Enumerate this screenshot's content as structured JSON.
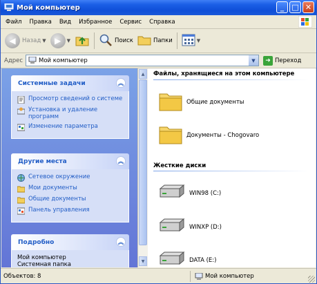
{
  "window": {
    "title": "Мой компьютер",
    "controls": {
      "minimize": "_",
      "maximize": "□",
      "close": "✕"
    }
  },
  "menu": [
    "Файл",
    "Правка",
    "Вид",
    "Избранное",
    "Сервис",
    "Справка"
  ],
  "toolbar": {
    "back_label": "Назад",
    "search_label": "Поиск",
    "folders_label": "Папки"
  },
  "address": {
    "label": "Адрес",
    "value": "Мой компьютер",
    "go_label": "Переход"
  },
  "left_pane": {
    "system_tasks": {
      "title": "Системные задачи",
      "items": [
        "Просмотр сведений о системе",
        "Установка и удаление программ",
        "Изменение параметра"
      ]
    },
    "other_places": {
      "title": "Другие места",
      "items": [
        "Сетевое окружение",
        "Мои документы",
        "Общие документы",
        "Панель управления"
      ]
    },
    "details": {
      "title": "Подробно",
      "lines": [
        "Мой компьютер",
        "Системная папка"
      ]
    }
  },
  "content": {
    "files_group": {
      "title": "Файлы, хранящиеся на этом компьютере",
      "items": [
        "Общие документы",
        "Документы - Chogovaro"
      ]
    },
    "drives_group": {
      "title": "Жесткие диски",
      "items": [
        "WIN98 (C:)",
        "WINXP (D:)",
        "DATA (E:)"
      ]
    }
  },
  "status": {
    "objects": "Объектов: 8",
    "location": "Мой компьютер"
  },
  "colors": {
    "titlebar": "#0f4fd8",
    "task_pane": "#6375d6",
    "link": "#215dc6"
  }
}
